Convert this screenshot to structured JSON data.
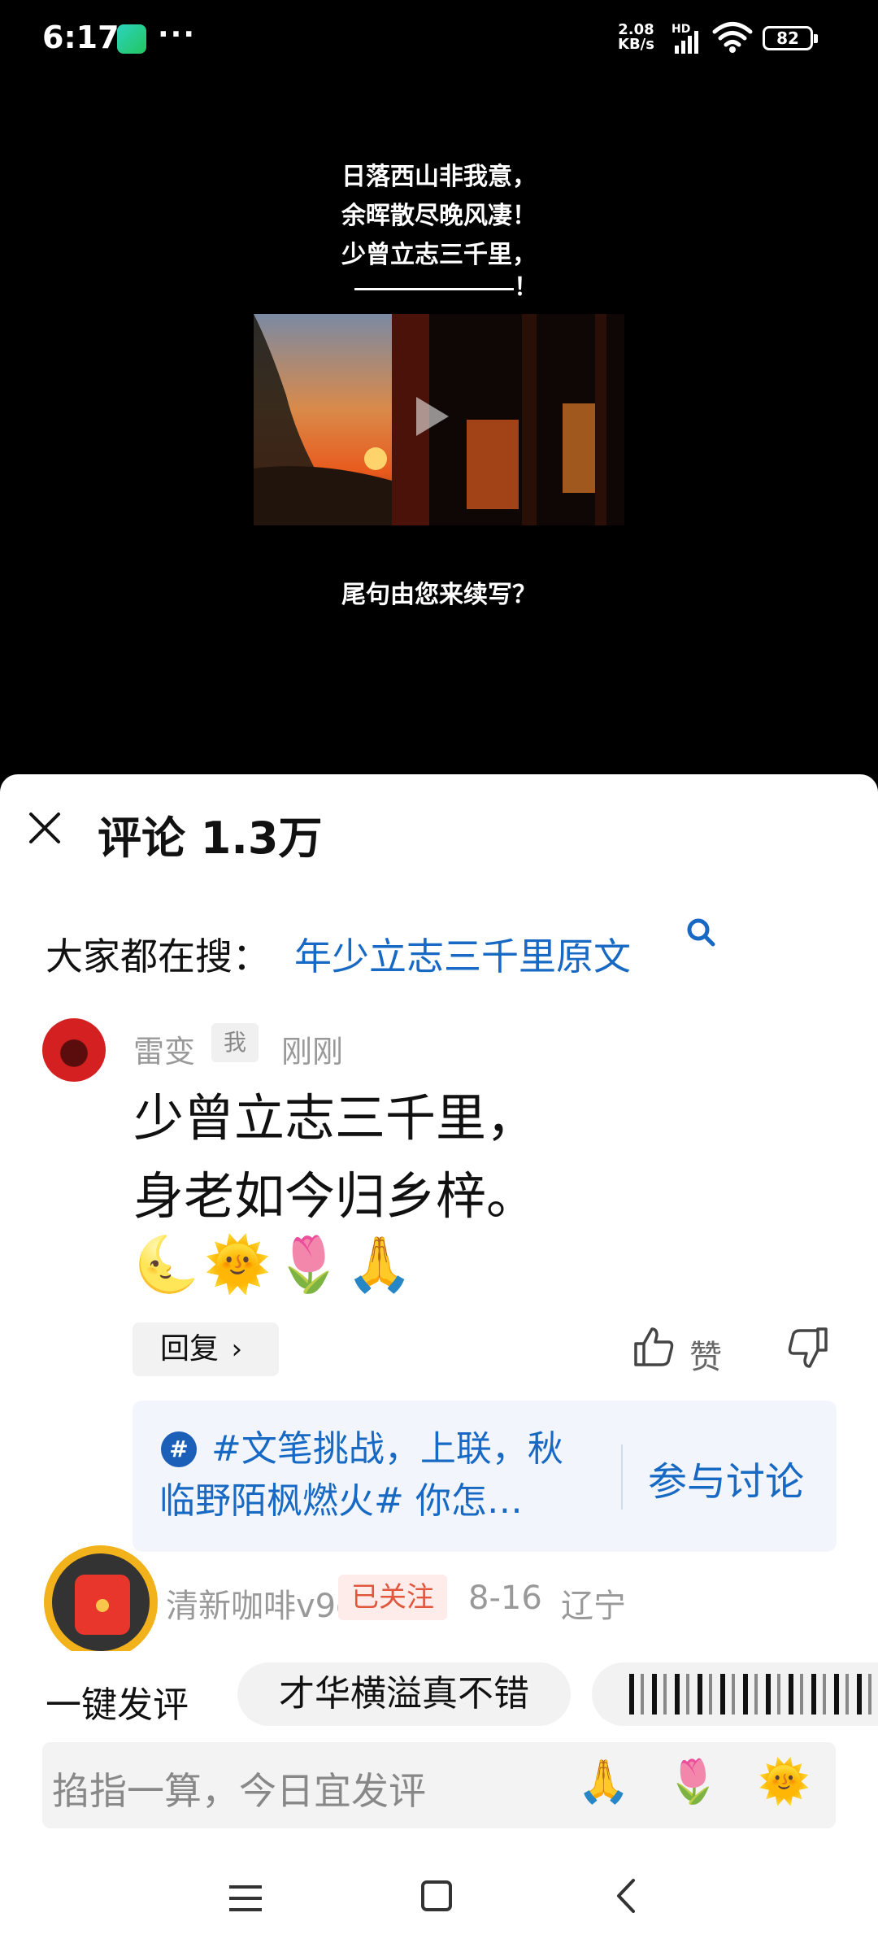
{
  "status_bar": {
    "time": "6:17",
    "dots": "···",
    "net_speed_value": "2.08",
    "net_speed_unit": "KB/s",
    "net_type": "HD",
    "battery": "82",
    "icons": [
      "app-icon",
      "signal-icon",
      "wifi-icon",
      "battery-icon"
    ]
  },
  "video": {
    "poem_lines": [
      "日落西山非我意，",
      "余晖散尽晚风凄！",
      "少曾立志三千里，"
    ],
    "blank_suffix": "！",
    "question": "尾句由您来续写？",
    "icons": [
      "play-icon"
    ]
  },
  "comments": {
    "title": "评论 1.3万",
    "search_prefix": "大家都在搜：",
    "search_term": "年少立志三千里原文",
    "first": {
      "username": "雷变",
      "badge": "我",
      "time": "刚刚",
      "line1": "少曾立志三千里，",
      "line2": "身老如今归乡梓。",
      "emojis": [
        "🌜",
        "🌞",
        "🌷",
        "🙏"
      ],
      "reply_label": "回复",
      "like_label": "赞"
    },
    "topic": {
      "text": "#文笔挑战，上联，秋临野陌枫燃火# 你怎…",
      "join_label": "参与讨论"
    },
    "second": {
      "username": "清新咖啡v9d",
      "followed_label": "已关注",
      "date": "8-16",
      "location": "辽宁"
    }
  },
  "quick_reply": {
    "label": "一键发评",
    "chip1": "才华横溢真不错"
  },
  "input": {
    "placeholder": "掐指一算，今日宜发评",
    "emoji_buttons": [
      "🙏",
      "🌷",
      "🌞"
    ]
  },
  "colors": {
    "link_blue": "#1769c4",
    "follow_red": "#e0573e",
    "ring_gold": "#f2b21b"
  }
}
